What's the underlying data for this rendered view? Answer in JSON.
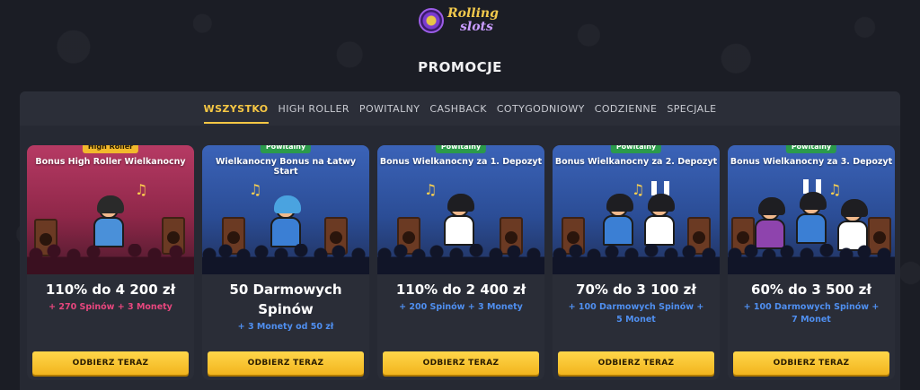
{
  "brand": {
    "logo_line1": "Rolling",
    "logo_line2": "slots"
  },
  "page": {
    "title": "PROMOCJE"
  },
  "tabs": [
    {
      "label": "WSZYSTKO",
      "active": true
    },
    {
      "label": "HIGH ROLLER",
      "active": false
    },
    {
      "label": "POWITALNY",
      "active": false
    },
    {
      "label": "CASHBACK",
      "active": false
    },
    {
      "label": "COTYGODNIOWY",
      "active": false
    },
    {
      "label": "CODZIENNE",
      "active": false
    },
    {
      "label": "SPECJALE",
      "active": false
    }
  ],
  "cards": [
    {
      "badge": "High Roller",
      "badge_color": "#f2b92c",
      "title": "Bonus High Roller Wielkanocny",
      "offer": "110% do 4 200 zł",
      "sub": "+ 270 Spinów + 3 Monety",
      "sub_color": "#e8467e",
      "button": "ODBIERZ TERAZ"
    },
    {
      "badge": "Powitalny",
      "badge_color": "#2b9a4b",
      "title": "Wielkanocny Bonus na Łatwy Start",
      "offer": "50 Darmowych Spinów",
      "sub": "+ 3 Monety od 50 zł",
      "sub_color": "#4f8ff0",
      "button": "ODBIERZ TERAZ"
    },
    {
      "badge": "Powitalny",
      "badge_color": "#2b9a4b",
      "title": "Bonus Wielkanocny za 1. Depozyt",
      "offer": "110% do 2 400 zł",
      "sub": "+ 200 Spinów + 3 Monety",
      "sub_color": "#4f8ff0",
      "button": "ODBIERZ TERAZ"
    },
    {
      "badge": "Powitalny",
      "badge_color": "#2b9a4b",
      "title": "Bonus Wielkanocny za 2. Depozyt",
      "offer": "70% do 3 100 zł",
      "sub": "+ 100 Darmowych Spinów + 5 Monet",
      "sub_color": "#4f8ff0",
      "button": "ODBIERZ TERAZ"
    },
    {
      "badge": "Powitalny",
      "badge_color": "#2b9a4b",
      "title": "Bonus Wielkanocny za 3. Depozyt",
      "offer": "60% do 3 500 zł",
      "sub": "+ 100 Darmowych Spinów + 7 Monet",
      "sub_color": "#4f8ff0",
      "button": "ODBIERZ TERAZ"
    }
  ],
  "colors": {
    "accent": "#f6c744",
    "background": "#1b1d25",
    "panel": "#262933"
  }
}
